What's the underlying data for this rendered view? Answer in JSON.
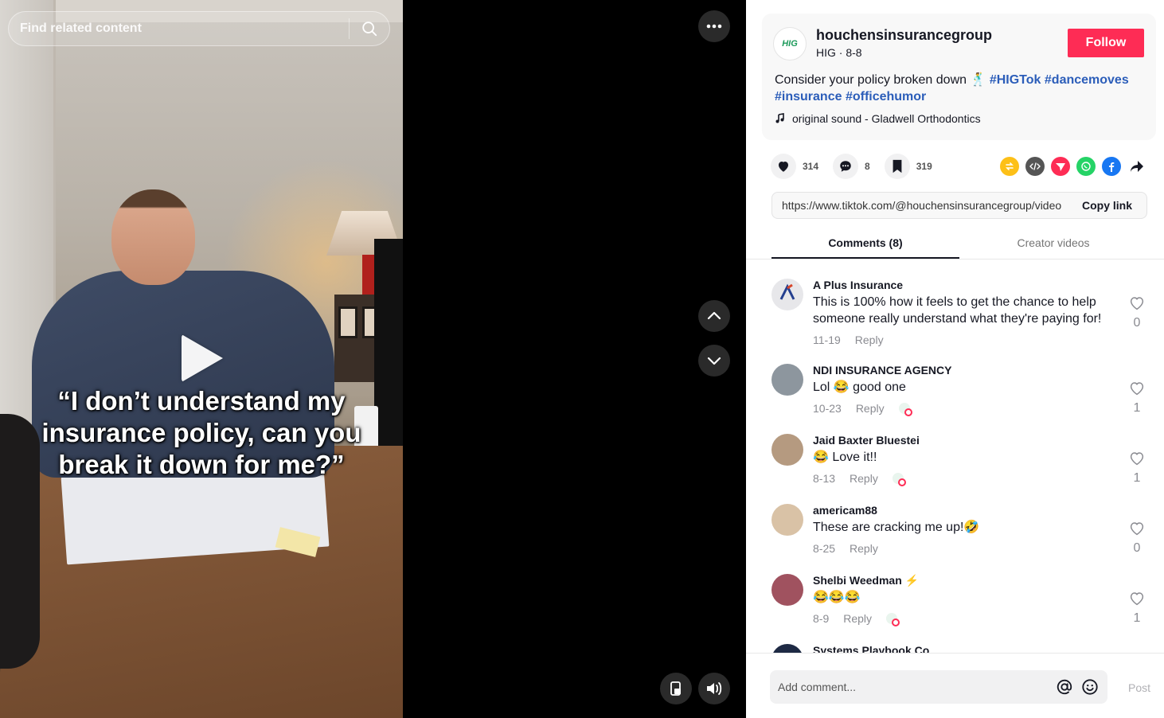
{
  "search": {
    "placeholder": "Find related content"
  },
  "video": {
    "caption": "“I don’t understand my insurance policy, can you break it down for me?”"
  },
  "author": {
    "avatar_text": "HIG",
    "username": "houchensinsurancegroup",
    "subtitle": "HIG · 8-8",
    "follow_label": "Follow"
  },
  "description": {
    "text": "Consider your policy broken down 🕺 ",
    "hashtags": [
      "#HIGTok",
      "#dancemoves",
      "#insurance",
      "#officehumor"
    ],
    "music": "original sound - Gladwell Orthodontics"
  },
  "stats": {
    "likes": "314",
    "comments": "8",
    "saves": "319"
  },
  "share": {
    "link": "https://www.tiktok.com/@houchensinsurancegroup/video",
    "copy_label": "Copy link",
    "colors": {
      "repost": "#fdc018",
      "embed": "#555555",
      "send": "#fe2c55",
      "whatsapp": "#25d366",
      "facebook": "#1877f2"
    }
  },
  "tabs": [
    {
      "label": "Comments (8)",
      "active": true
    },
    {
      "label": "Creator videos",
      "active": false
    }
  ],
  "comments": [
    {
      "user": "A Plus Insurance",
      "text": "This is 100% how it feels to get the chance to help someone really understand what they're paying for!",
      "date": "11-19",
      "reply": "Reply",
      "likes": "0",
      "creator_liked": false,
      "avatar_color": "#e7e7ea"
    },
    {
      "user": "NDI INSURANCE AGENCY",
      "text": "Lol 😂 good one",
      "date": "10-23",
      "reply": "Reply",
      "likes": "1",
      "creator_liked": true,
      "avatar_color": "#8d969e"
    },
    {
      "user": "Jaid Baxter Bluestei",
      "text": "😂 Love it!!",
      "date": "8-13",
      "reply": "Reply",
      "likes": "1",
      "creator_liked": true,
      "avatar_color": "#b59a80"
    },
    {
      "user": "americam88",
      "text": "These are cracking me up!🤣",
      "date": "8-25",
      "reply": "Reply",
      "likes": "0",
      "creator_liked": false,
      "avatar_color": "#d9c2a6"
    },
    {
      "user": "Shelbi Weedman",
      "user_badge": "⚡",
      "text": "😂😂😂",
      "date": "8-9",
      "reply": "Reply",
      "likes": "1",
      "creator_liked": true,
      "avatar_color": "#a0525f"
    },
    {
      "user": "Systems Playbook Co",
      "text": "",
      "date": "",
      "reply": "",
      "likes": "",
      "creator_liked": false,
      "avatar_color": "#1e2a44"
    }
  ],
  "comment_box": {
    "placeholder": "Add comment...",
    "post_label": "Post"
  }
}
